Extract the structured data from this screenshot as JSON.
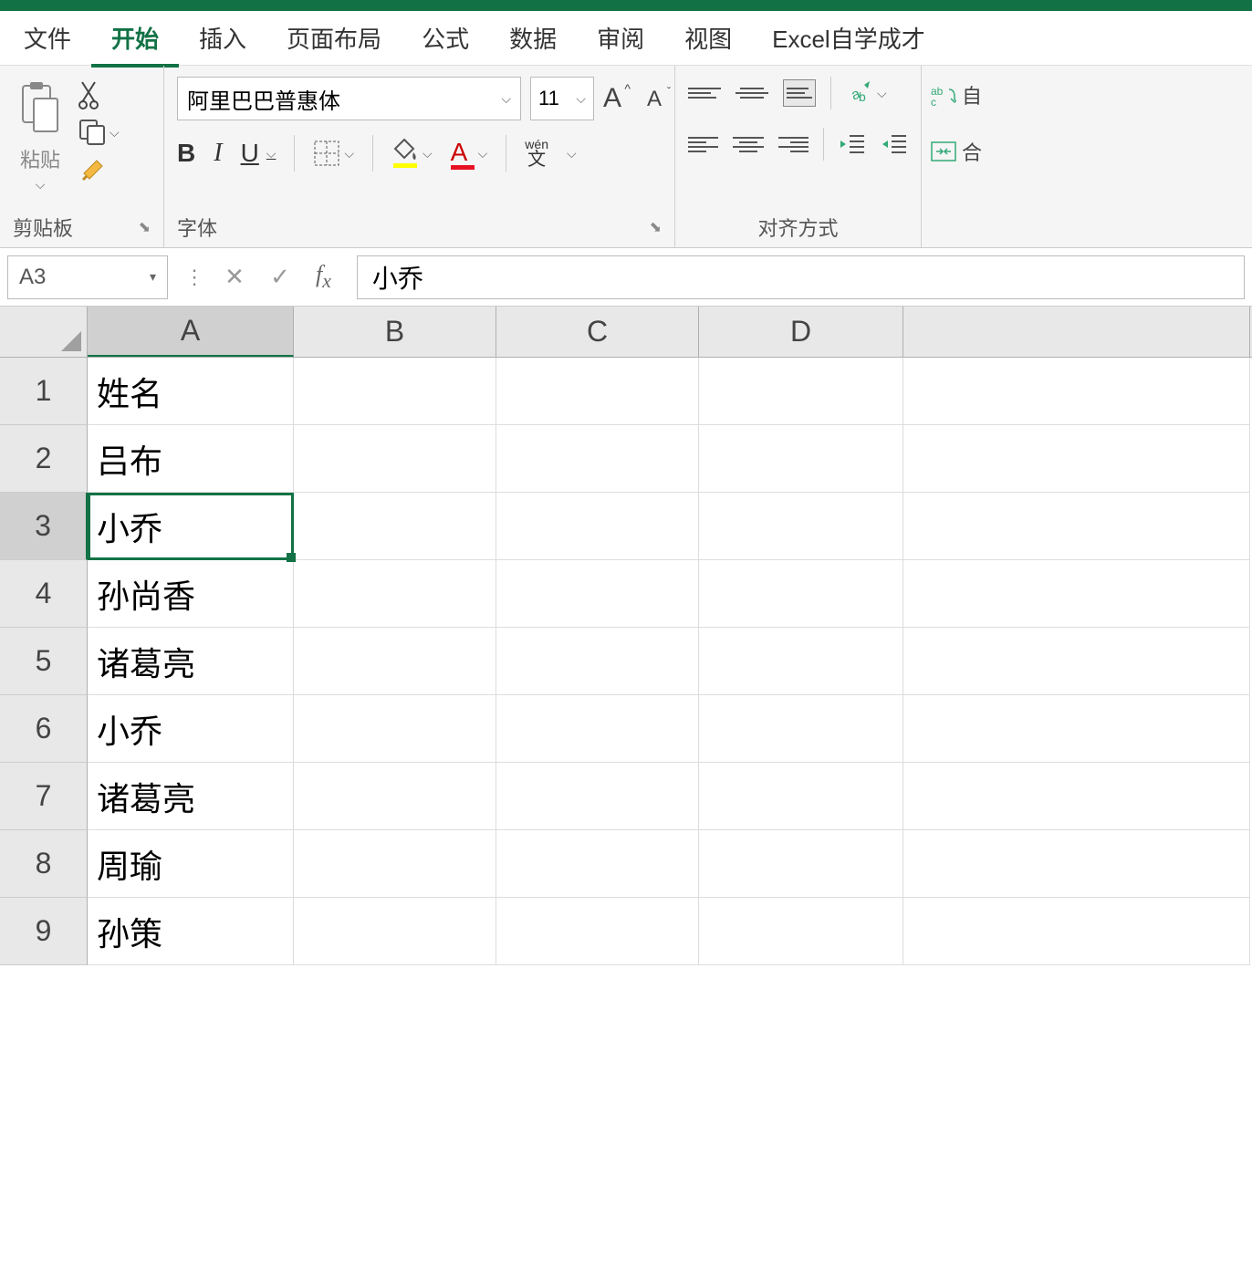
{
  "tabs": {
    "file": "文件",
    "home": "开始",
    "insert": "插入",
    "page_layout": "页面布局",
    "formulas": "公式",
    "data": "数据",
    "review": "审阅",
    "view": "视图",
    "excel_self": "Excel自学成才"
  },
  "ribbon": {
    "clipboard": {
      "label": "剪贴板",
      "paste": "粘贴"
    },
    "font": {
      "label": "字体",
      "name": "阿里巴巴普惠体",
      "size": "11",
      "wen": "wén",
      "wen2": "文"
    },
    "align": {
      "label": "对齐方式"
    },
    "wrap": {
      "wrap_text": "自",
      "merge": "合"
    }
  },
  "formula_bar": {
    "name_box": "A3",
    "content": "小乔"
  },
  "columns": [
    "A",
    "B",
    "C",
    "D"
  ],
  "rows": [
    {
      "n": "1",
      "A": "姓名"
    },
    {
      "n": "2",
      "A": "吕布"
    },
    {
      "n": "3",
      "A": "小乔"
    },
    {
      "n": "4",
      "A": "孙尚香"
    },
    {
      "n": "5",
      "A": "诸葛亮"
    },
    {
      "n": "6",
      "A": "小乔"
    },
    {
      "n": "7",
      "A": "诸葛亮"
    },
    {
      "n": "8",
      "A": "周瑜"
    },
    {
      "n": "9",
      "A": "孙策"
    }
  ],
  "selected": {
    "col": "A",
    "row": "3"
  }
}
